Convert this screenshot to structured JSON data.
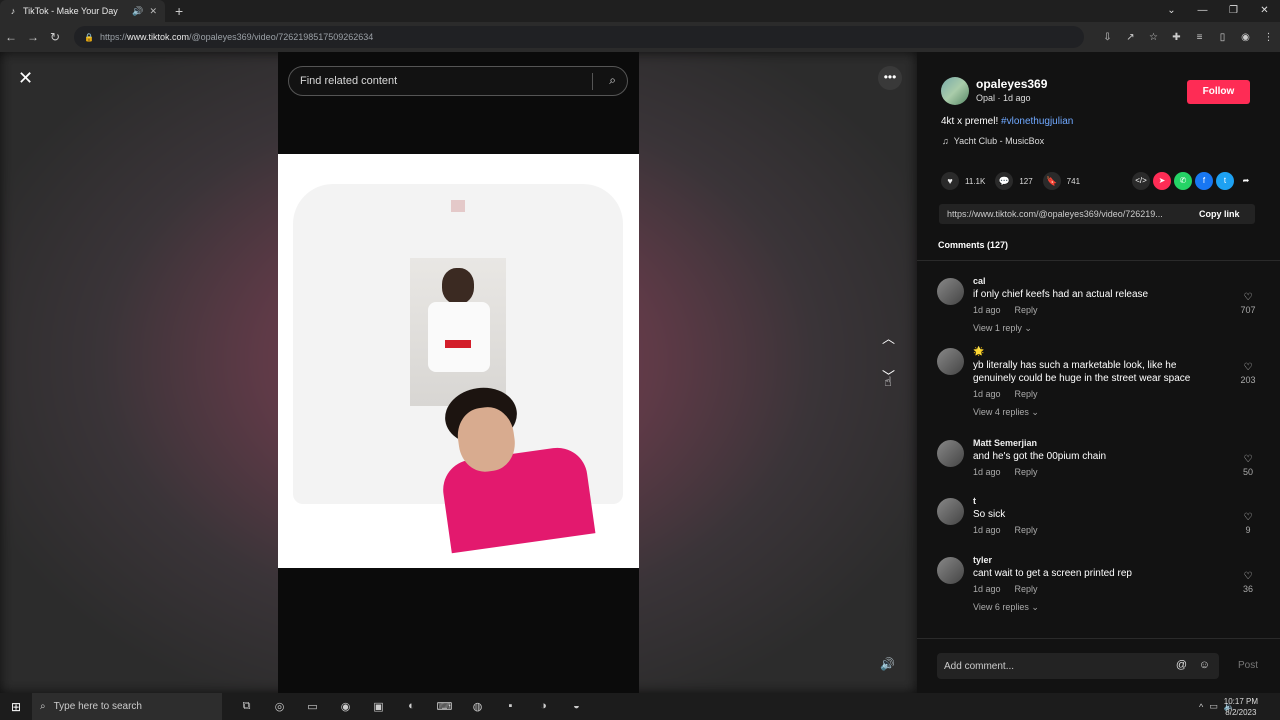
{
  "browser": {
    "tab_title": "TikTok - Make Your Day",
    "url_prefix": "https://",
    "url_host": "www.tiktok.com",
    "url_path": "/@opaleyes369/video/7262198517509262634"
  },
  "video": {
    "search_placeholder": "Find related content"
  },
  "panel": {
    "username": "opaleyes369",
    "subline": "Opal · 1d ago",
    "follow_label": "Follow",
    "caption_text": "4kt x premel! ",
    "caption_hashtag": "#vlonethugjulian",
    "music": "Yacht Club - MusicBox",
    "likes": "11.1K",
    "comments_count": "127",
    "saves": "741",
    "share_link": "https://www.tiktok.com/@opaleyes369/video/726219...",
    "copy_link_label": "Copy link",
    "comments_title": "Comments (127)",
    "comments": [
      {
        "user": "cal",
        "text": "if only chief keefs had an actual release",
        "time": "1d ago",
        "reply": "Reply",
        "likes": "707",
        "view_replies": "View 1 reply ⌄"
      },
      {
        "user": "🌟",
        "text": "yb literally has such a marketable look, like he genuinely could be huge in the street wear space",
        "time": "1d ago",
        "reply": "Reply",
        "likes": "203",
        "view_replies": "View 4 replies ⌄"
      },
      {
        "user": "Matt Semerjian",
        "text": "and he's got the 00pium chain",
        "time": "1d ago",
        "reply": "Reply",
        "likes": "50",
        "view_replies": ""
      },
      {
        "user": "t",
        "text": "So sick",
        "time": "1d ago",
        "reply": "Reply",
        "likes": "9",
        "view_replies": ""
      },
      {
        "user": "tyler",
        "text": "cant wait to get a screen printed rep",
        "time": "1d ago",
        "reply": "Reply",
        "likes": "36",
        "view_replies": "View 6 replies ⌄"
      }
    ],
    "add_comment_placeholder": "Add comment...",
    "post_label": "Post"
  },
  "taskbar": {
    "search_placeholder": "Type here to search",
    "time": "10:17 PM",
    "date": "8/2/2023"
  },
  "colors": {
    "accent": "#fe2c55",
    "hashtag": "#6fa8ff"
  }
}
